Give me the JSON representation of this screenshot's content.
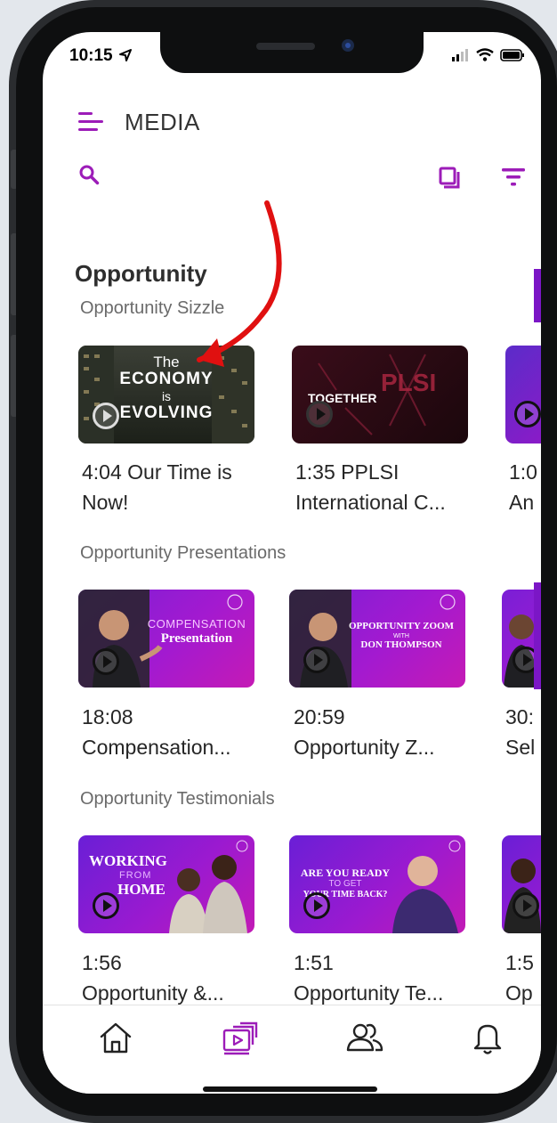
{
  "status_bar": {
    "time": "10:15"
  },
  "header": {
    "title": "MEDIA"
  },
  "section": {
    "title": "Opportunity"
  },
  "categories": [
    {
      "label": "Opportunity Sizzle",
      "videos": [
        {
          "duration": "4:04",
          "title": "Our Time is Now!",
          "thumb_lines": [
            "The",
            "ECONOMY",
            "is",
            "EVOLVING"
          ]
        },
        {
          "duration": "1:35",
          "title": "PPLSI International C...",
          "thumb_lines": [
            "TOGETHER",
            "PLSI"
          ]
        },
        {
          "duration": "1:0",
          "title": "An"
        }
      ]
    },
    {
      "label": "Opportunity Presentations",
      "videos": [
        {
          "duration": "18:08",
          "title": "Compensation...",
          "thumb_lines": [
            "COMPENSATION",
            "Presentation"
          ]
        },
        {
          "duration": "20:59",
          "title": "Opportunity Z...",
          "thumb_lines": [
            "OPPORTUNITY ZOOM",
            "WITH",
            "DON THOMPSON"
          ]
        },
        {
          "duration": "30:",
          "title": "Sel"
        }
      ]
    },
    {
      "label": "Opportunity Testimonials",
      "videos": [
        {
          "duration": "1:56",
          "title": "Opportunity &...",
          "thumb_lines": [
            "WORKING",
            "FROM",
            "HOME"
          ]
        },
        {
          "duration": "1:51",
          "title": "Opportunity Te...",
          "thumb_lines": [
            "ARE YOU READY",
            "TO GET",
            "YOUR TIME BACK?"
          ]
        },
        {
          "duration": "1:5",
          "title": "Op"
        }
      ]
    }
  ],
  "bottom_nav": [
    "home-icon",
    "media-icon",
    "people-icon",
    "bell-icon"
  ],
  "colors": {
    "accent": "#9c1cb8",
    "annotation_arrow": "#e01010"
  }
}
